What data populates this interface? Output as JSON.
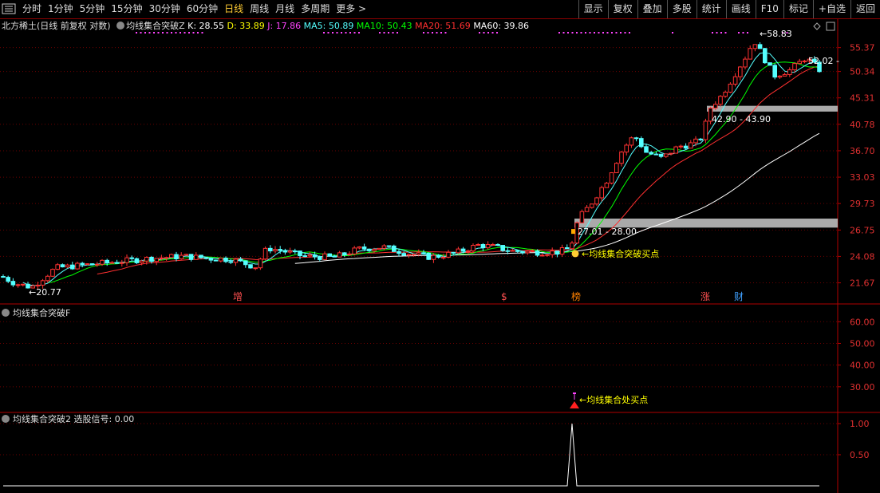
{
  "toolbar": {
    "periods": [
      "分时",
      "1分钟",
      "5分钟",
      "15分钟",
      "30分钟",
      "60分钟",
      "日线",
      "周线",
      "月线",
      "多周期",
      "更多 >"
    ],
    "active_period": "日线",
    "buttons": [
      "显示",
      "复权",
      "叠加",
      "多股",
      "统计",
      "画线",
      "F10",
      "标记",
      "+自选",
      "返回"
    ]
  },
  "main_panel": {
    "stock_name": "北方稀土",
    "mode": "(日线 前复权 对数)",
    "indicator_name": "均线集合突破Z",
    "k": "K: 28.55",
    "d": "D: 33.89",
    "j": "J: 17.86",
    "ma5": "MA5: 50.89",
    "ma10": "MA10: 50.43",
    "ma20": "MA20: 51.69",
    "ma60": "MA60: 39.86",
    "high_label": "58.83",
    "low_label": "20.77",
    "last_label": "52.02",
    "zone_upper_label": "42.90 - 43.90",
    "zone_lower_label": "27.01 - 28.00",
    "buy_point_label": "均线集合突破买点",
    "event_markers": [
      "增",
      "$",
      "榜",
      "涨",
      "财"
    ],
    "y_ticks": [
      "55.37",
      "50.34",
      "45.31",
      "40.78",
      "36.70",
      "33.03",
      "29.73",
      "26.75",
      "24.08",
      "21.67"
    ]
  },
  "sub_panel_1": {
    "indicator_name": "均线集合突破F",
    "signal_label": "←均线集合处买点",
    "y_ticks": [
      "60.00",
      "50.00",
      "40.00",
      "30.00"
    ]
  },
  "sub_panel_2": {
    "indicator_name": "均线集合突破2",
    "signal_text": "选股信号: 0.00",
    "y_ticks": [
      "1.00",
      "0.50"
    ]
  },
  "colors": {
    "up": "#ff3232",
    "down": "#54ffff",
    "ma5": "#ffffff",
    "ma10": "#ffff00",
    "ma20": "#ff3030",
    "ma60": "#ffffff",
    "k_color": "#ffffff",
    "d_color": "#ffff00",
    "j_color": "#ff00ff",
    "ma5_color": "#54ffff",
    "ma10_color": "#00ff00",
    "ma20_color": "#ff3030",
    "ma60_color": "#ffffff",
    "grid": "#8b0000",
    "zone": "#aaaaaa"
  }
}
